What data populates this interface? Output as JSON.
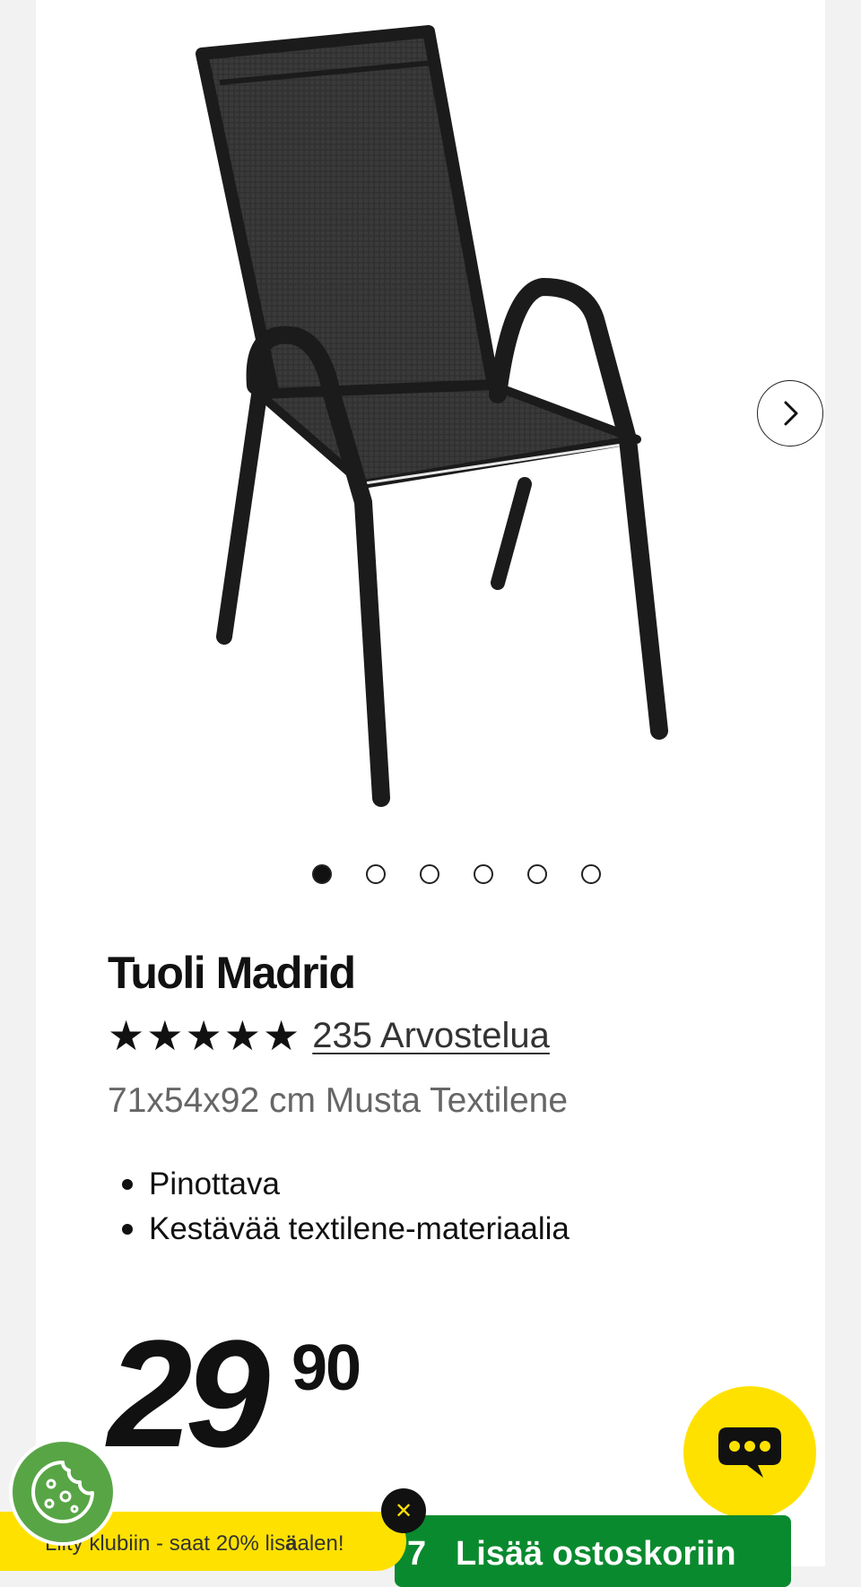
{
  "product": {
    "title": "Tuoli Madrid",
    "rating": 5,
    "rating_max": 5,
    "reviews_label": "235 Arvostelua",
    "subtitle": "71x54x92 cm Musta Textilene",
    "features": [
      "Pinottava",
      "Kestävää textilene-materiaalia"
    ],
    "price_int": "29",
    "price_dec": "90"
  },
  "gallery": {
    "total_images": 6,
    "active_index": 0
  },
  "cart": {
    "quantity_partial": "7",
    "button_label": "Lisää ostoskoriin"
  },
  "promo": {
    "text_before": "Liity klubiin - saat 20% lis",
    "text_bold": "ä",
    "text_after": "alen!",
    "close_glyph": "✕"
  },
  "colors": {
    "accent_yellow": "#ffe100",
    "cart_green": "#0a8a2e",
    "cookie_green": "#58a546",
    "chair_frame": "#1b1b1b",
    "chair_mesh": "#3a3a3a"
  },
  "icons": {
    "next": "chevron-right-icon",
    "chat": "chat-bubble-icon",
    "cookie": "cookie-icon",
    "close": "close-icon"
  }
}
